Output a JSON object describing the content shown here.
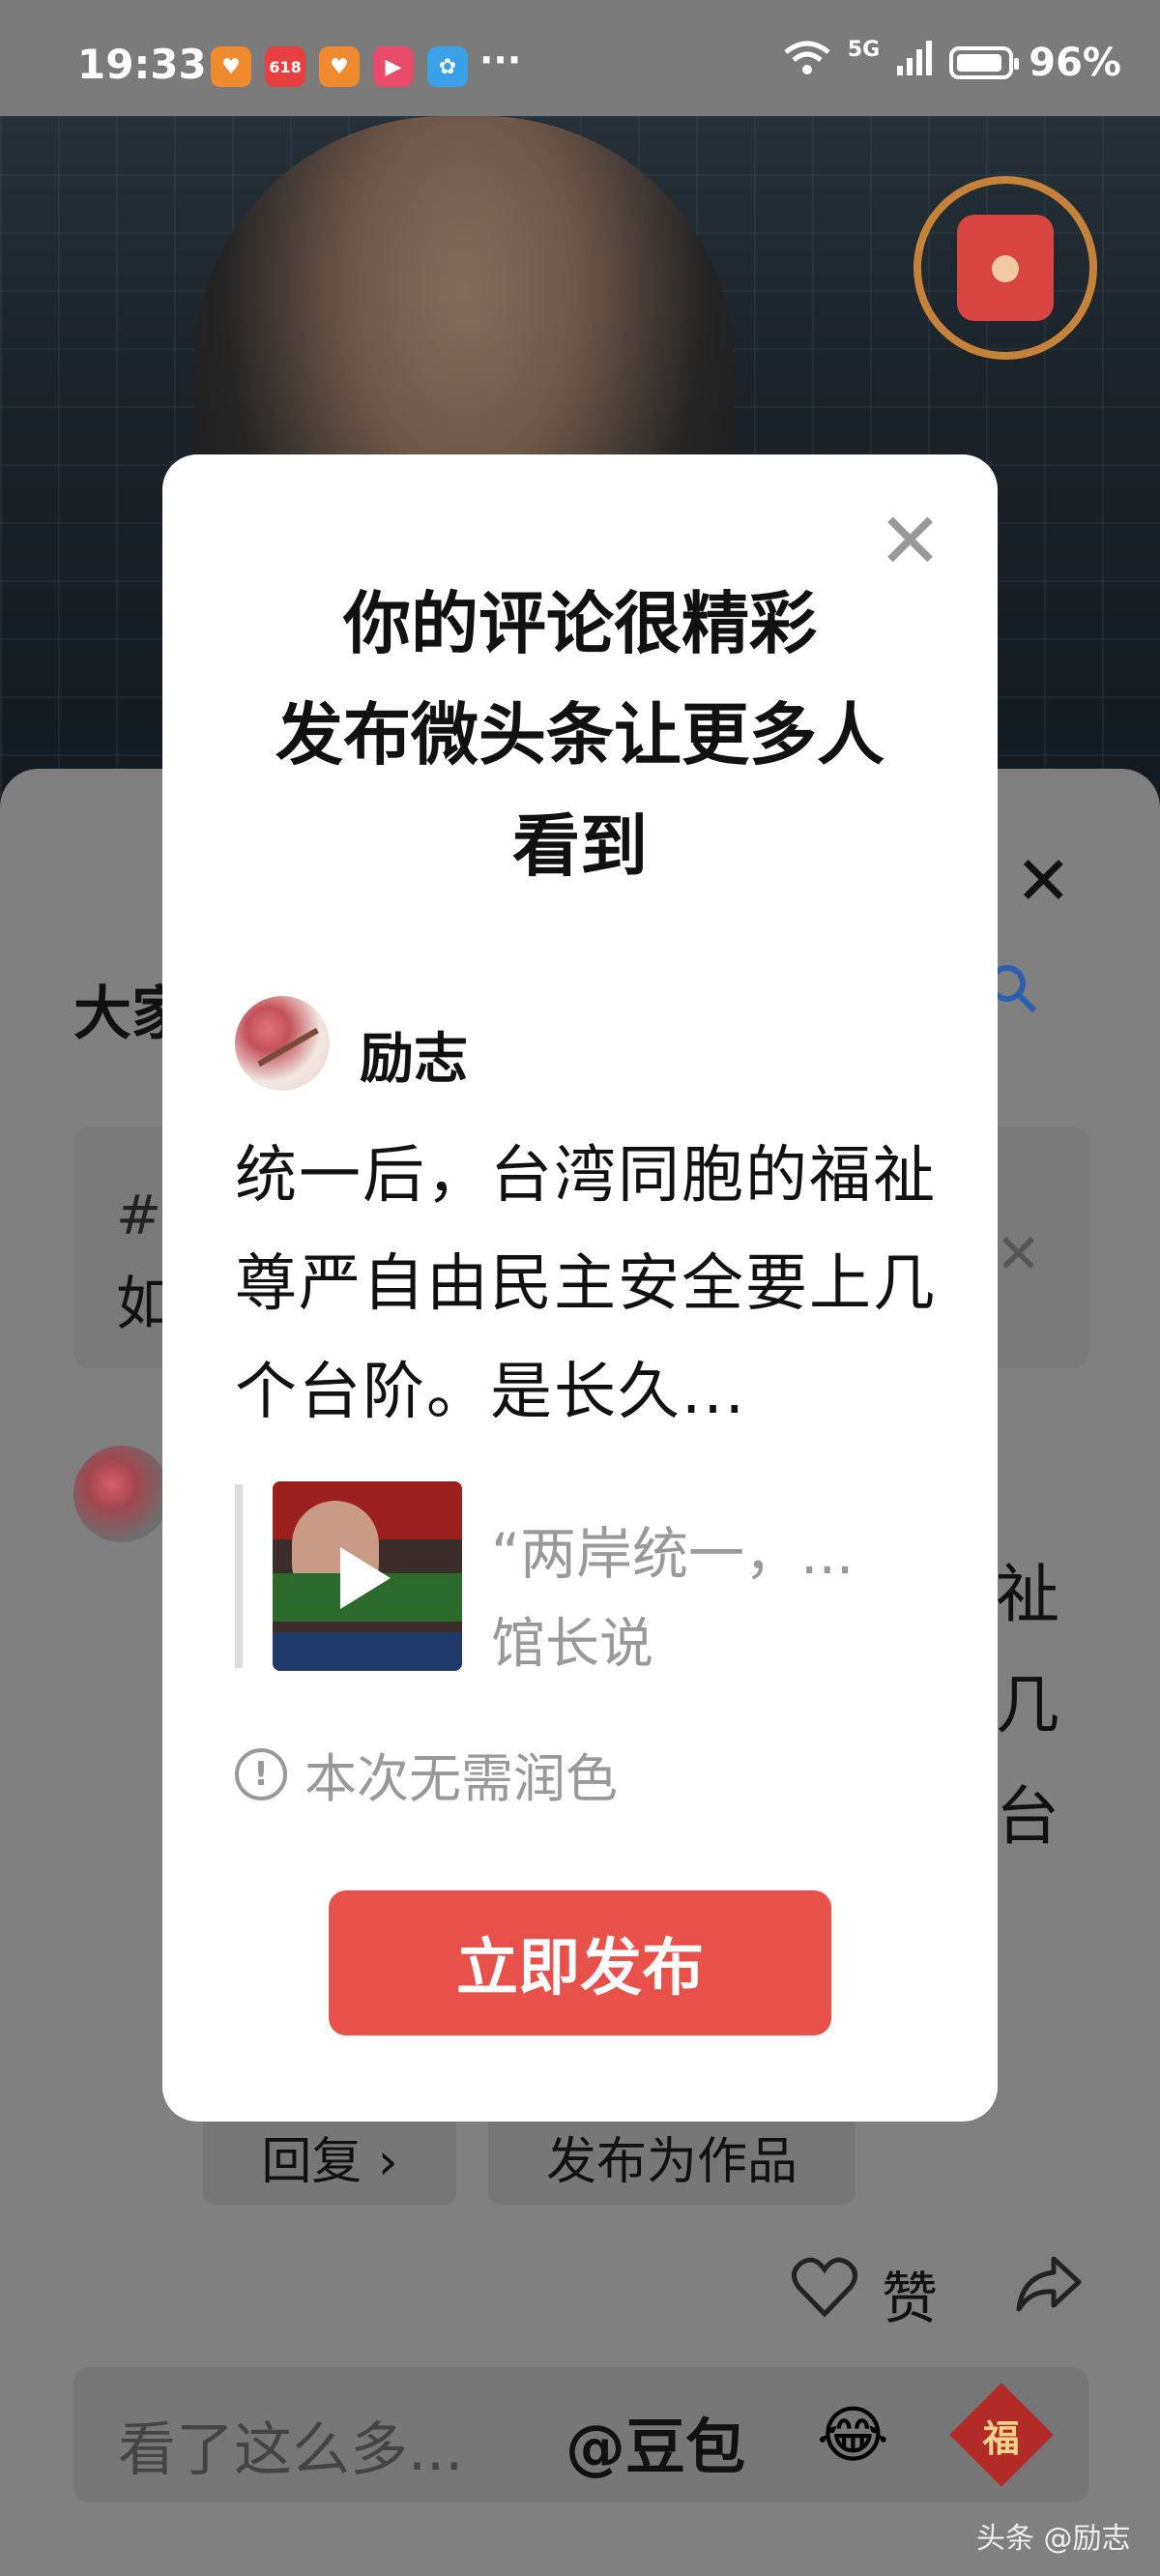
{
  "status_bar": {
    "time": "19:33",
    "app_icons": [
      {
        "icon": "heart-app-icon",
        "glyph": "♥",
        "color": "#f08a2e"
      },
      {
        "icon": "618-app-icon",
        "glyph": "618",
        "color": "#e84040"
      },
      {
        "icon": "heart-app-icon-2",
        "glyph": "♥",
        "color": "#f08a2e"
      },
      {
        "icon": "play-app-icon",
        "glyph": "▶",
        "color": "#e84b6a"
      },
      {
        "icon": "pinwheel-app-icon",
        "glyph": "✿",
        "color": "#3aa0e8"
      }
    ],
    "more": "···",
    "network": "5G",
    "battery": "96%"
  },
  "sheet": {
    "title_partial": "大家",
    "topic_icon_partial": "#",
    "topic_text_partial": "如",
    "right_chars": [
      "祉",
      "几",
      "台"
    ],
    "reply_label": "回复 ›",
    "publish_work_label": "发布为作品",
    "like_label": "赞",
    "input_placeholder": "看了这么多...",
    "mention": "@豆包"
  },
  "modal": {
    "title_lines": [
      "你的评论很精彩",
      "发布微头条让更多人",
      "看到"
    ],
    "author": "励志",
    "body": "统一后，台湾同胞的福祉尊严自由民主安全要上几个台阶。是长久...",
    "quote_title": "“两岸统一，...",
    "quote_author": "馆长说",
    "polish_note": "本次无需润色",
    "publish_label": "立即发布"
  },
  "watermark": "头条 @励志",
  "colors": {
    "publish_button": "#e8504a",
    "overlay": "#808080"
  }
}
